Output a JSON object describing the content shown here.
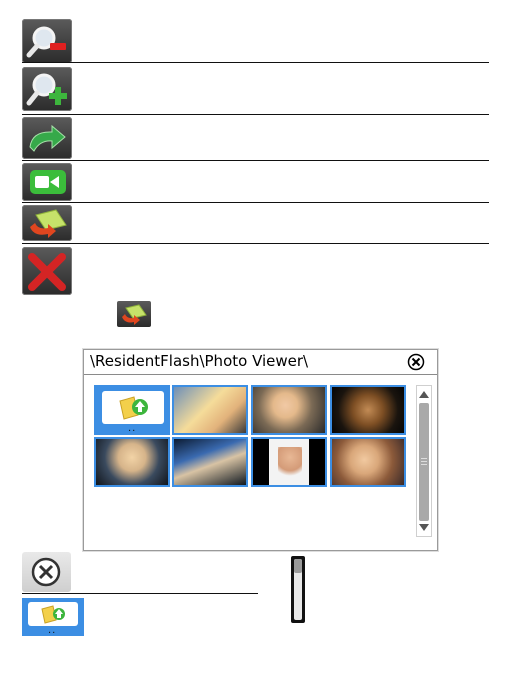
{
  "toolbar_icons": [
    {
      "name": "zoom-out-icon"
    },
    {
      "name": "zoom-in-icon"
    },
    {
      "name": "rotate-icon"
    },
    {
      "name": "video-icon"
    },
    {
      "name": "slideshow-icon"
    },
    {
      "name": "close-x-icon"
    }
  ],
  "viewer": {
    "path": "\\ResidentFlash\\Photo Viewer\\",
    "folder_dots": "..",
    "thumbnails": [
      "photo-1",
      "photo-2",
      "photo-3",
      "photo-4",
      "photo-5",
      "photo-6",
      "photo-7"
    ]
  },
  "bottom": {
    "folder_dots": ".."
  },
  "colors": {
    "tile_dark": "#2b2b2b",
    "selection_blue": "#3c8ee3",
    "zoom_red": "#e02020",
    "zoom_green": "#3db53d",
    "scrollbar_gray": "#a9a9a9"
  }
}
